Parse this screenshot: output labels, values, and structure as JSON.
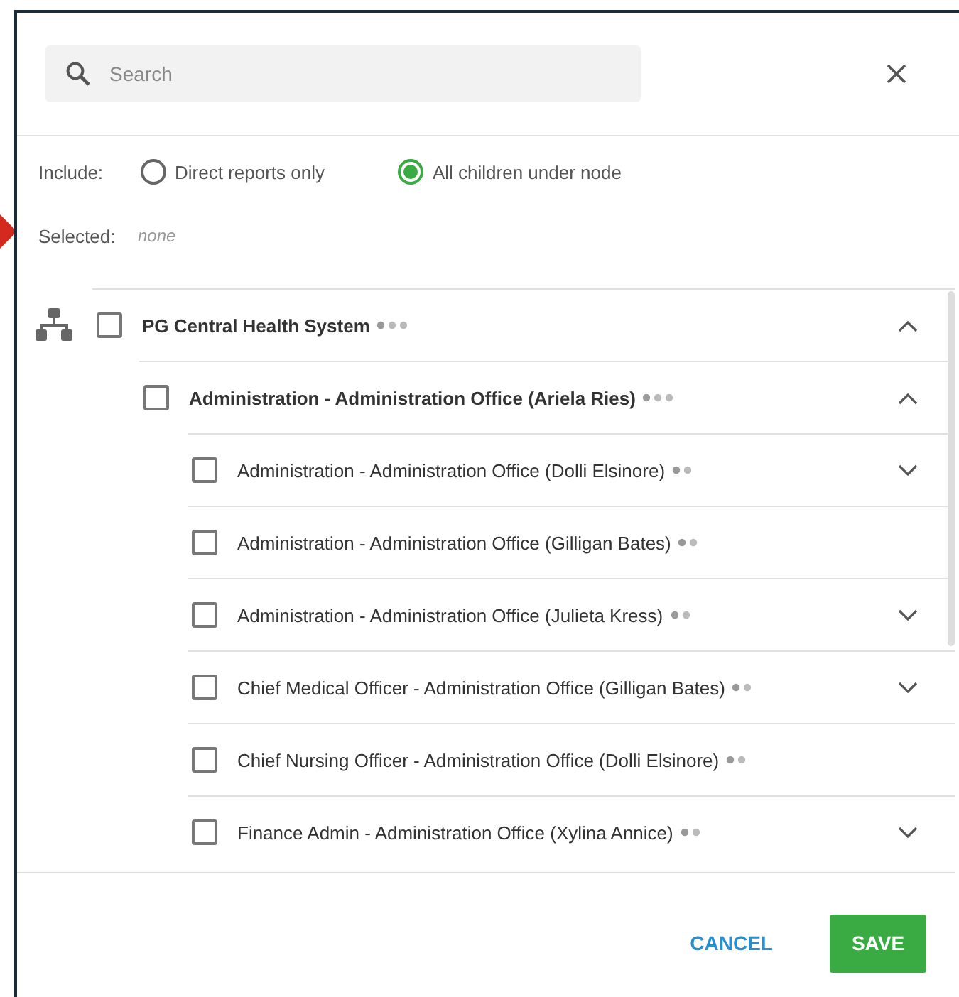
{
  "search": {
    "placeholder": "Search"
  },
  "include": {
    "label": "Include:",
    "options": [
      {
        "label": "Direct reports only",
        "selected": false
      },
      {
        "label": "All children under node",
        "selected": true
      }
    ]
  },
  "selected": {
    "label": "Selected:",
    "value": "none"
  },
  "tree": [
    {
      "label": "PG Central Health System",
      "checked": false,
      "expandable": true,
      "expanded": true,
      "children": [
        {
          "label": "Administration - Administration Office (Ariela Ries)",
          "checked": false,
          "expandable": true,
          "expanded": true,
          "children": [
            {
              "label": "Administration - Administration Office (Dolli Elsinore)",
              "checked": false,
              "expandable": true,
              "expanded": false
            },
            {
              "label": "Administration - Administration Office (Gilligan Bates)",
              "checked": false,
              "expandable": false
            },
            {
              "label": "Administration - Administration Office (Julieta Kress)",
              "checked": false,
              "expandable": true,
              "expanded": false
            },
            {
              "label": "Chief Medical Officer - Administration Office (Gilligan Bates)",
              "checked": false,
              "expandable": true,
              "expanded": false
            },
            {
              "label": "Chief Nursing Officer - Administration Office (Dolli Elsinore)",
              "checked": false,
              "expandable": false
            },
            {
              "label": "Finance Admin - Administration Office (Xylina Annice)",
              "checked": false,
              "expandable": true,
              "expanded": false
            }
          ]
        }
      ]
    }
  ],
  "buttons": {
    "cancel": "CANCEL",
    "save": "SAVE"
  }
}
